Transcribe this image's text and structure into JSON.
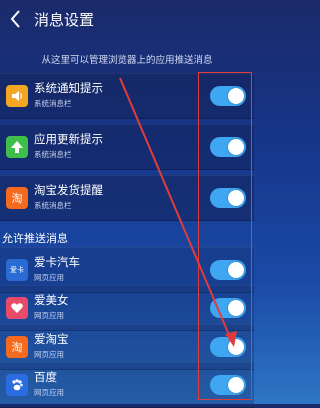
{
  "header": {
    "title": "消息设置"
  },
  "description": "从这里可以管理浏览器上的应用推送消息",
  "system_rows": [
    {
      "label": "系统通知提示",
      "sublabel": "系统消息栏",
      "icon": "speaker-icon",
      "icon_color": "#f5a623",
      "enabled": true
    },
    {
      "label": "应用更新提示",
      "sublabel": "系统消息栏",
      "icon": "upload-arrow-icon",
      "icon_color": "#3fbf4a",
      "enabled": true
    },
    {
      "label": "淘宝发货提醒",
      "sublabel": "系统消息栏",
      "icon": "taobao-icon",
      "icon_glyph": "淘",
      "icon_color": "#f56a1e",
      "enabled": true
    }
  ],
  "section_title": "允许推送消息",
  "app_rows": [
    {
      "label": "爱卡汽车",
      "sublabel": "网页应用",
      "icon": "xcar-icon",
      "icon_glyph": "爱卡",
      "icon_color": "#2a6bd6",
      "enabled": true
    },
    {
      "label": "爱美女",
      "sublabel": "网页应用",
      "icon": "heart-icon",
      "icon_color": "#e94b6a",
      "enabled": true
    },
    {
      "label": "爱淘宝",
      "sublabel": "网页应用",
      "icon": "taobao-icon",
      "icon_glyph": "淘",
      "icon_color": "#f56a1e",
      "enabled": true
    },
    {
      "label": "百度",
      "sublabel": "网页应用",
      "icon": "baidu-paw-icon",
      "icon_color": "#2b6de0",
      "enabled": true
    }
  ],
  "colors": {
    "toggle_on": "#3fa6f2",
    "annotation": "#e23b3b"
  }
}
